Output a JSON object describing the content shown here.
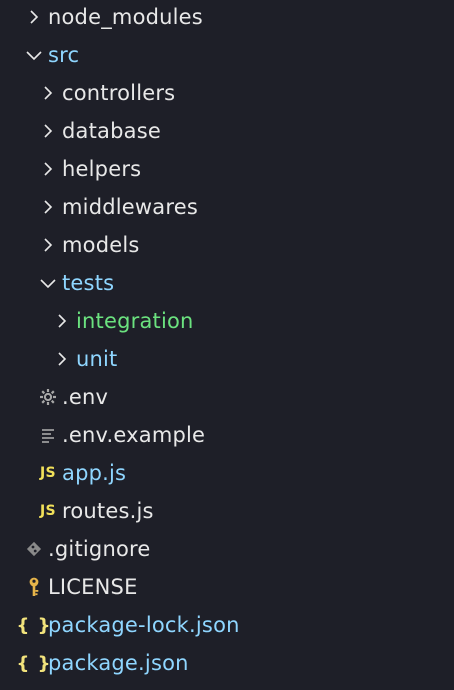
{
  "explorer": {
    "items": [
      {
        "label": "node_modules",
        "type": "folder",
        "state": "collapsed",
        "icon": "chevron-right-icon",
        "color": "#e8e8e8"
      },
      {
        "label": "src",
        "type": "folder",
        "state": "expanded",
        "icon": "chevron-down-icon",
        "color": "#8fd6ff"
      },
      {
        "label": "controllers",
        "type": "folder",
        "state": "collapsed",
        "icon": "chevron-right-icon",
        "color": "#e8e8e8"
      },
      {
        "label": "database",
        "type": "folder",
        "state": "collapsed",
        "icon": "chevron-right-icon",
        "color": "#e8e8e8"
      },
      {
        "label": "helpers",
        "type": "folder",
        "state": "collapsed",
        "icon": "chevron-right-icon",
        "color": "#e8e8e8"
      },
      {
        "label": "middlewares",
        "type": "folder",
        "state": "collapsed",
        "icon": "chevron-right-icon",
        "color": "#e8e8e8"
      },
      {
        "label": "models",
        "type": "folder",
        "state": "collapsed",
        "icon": "chevron-right-icon",
        "color": "#e8e8e8"
      },
      {
        "label": "tests",
        "type": "folder",
        "state": "expanded",
        "icon": "chevron-down-icon",
        "color": "#8fd6ff"
      },
      {
        "label": "integration",
        "type": "folder",
        "state": "collapsed",
        "icon": "chevron-right-icon",
        "color": "#6be27f"
      },
      {
        "label": "unit",
        "type": "folder",
        "state": "collapsed",
        "icon": "chevron-right-icon",
        "color": "#8fd6ff"
      },
      {
        "label": ".env",
        "type": "file",
        "icon": "gear-icon",
        "color": "#e8e8e8"
      },
      {
        "label": ".env.example",
        "type": "file",
        "icon": "text-lines-icon",
        "color": "#e8e8e8"
      },
      {
        "label": "app.js",
        "type": "file",
        "icon": "javascript-icon",
        "icon_text": "JS",
        "color": "#8fd6ff"
      },
      {
        "label": "routes.js",
        "type": "file",
        "icon": "javascript-icon",
        "icon_text": "JS",
        "color": "#e8e8e8"
      },
      {
        "label": ".gitignore",
        "type": "file",
        "icon": "git-diamond-icon",
        "color": "#e8e8e8"
      },
      {
        "label": "LICENSE",
        "type": "file",
        "icon": "key-icon",
        "color": "#e8e8e8"
      },
      {
        "label": "package-lock.json",
        "type": "file",
        "icon": "json-braces-icon",
        "icon_text": "{ }",
        "color": "#8fd6ff"
      },
      {
        "label": "package.json",
        "type": "file",
        "icon": "json-braces-icon",
        "icon_text": "{ }",
        "color": "#8fd6ff"
      }
    ]
  },
  "colors": {
    "background": "#1e1f28",
    "default_text": "#e8e8e8",
    "accent_blue": "#8fd6ff",
    "accent_green": "#6be27f",
    "js_yellow": "#f1e05a",
    "json_yellow": "#f2e37c",
    "muted_icon": "#a8a8a8",
    "license_icon": "#e6b44a"
  }
}
